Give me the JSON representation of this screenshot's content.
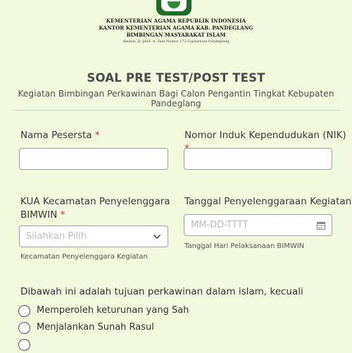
{
  "header": {
    "line1": "KEMENTERIAN AGAMA REPUBLIK INDONESIA",
    "line2": "KANTOR KEMENTERIAN AGAMA KAB. PANDEGLANG",
    "line3": "BIMBINGAN MASYARAKAT ISLAM",
    "address": "Alamat: Jl. Jend. A. Yani Nomor 172 Cigeureum Pandeglang"
  },
  "form": {
    "title": "SOAL PRE TEST/POST TEST",
    "subtitle": "Kegiatan Bimbingan Perkawinan Bagi Calon Pengantin Tingkat Kebupaten Pandeglang",
    "required_mark": "*",
    "fields": {
      "name": {
        "label": "Nama Pesersta",
        "value": ""
      },
      "nik": {
        "label": "Nomor Induk Kependudukan (NIK)",
        "value": ""
      },
      "kua": {
        "label_line1": "KUA Kecamatan Penyelenggara",
        "label_line2": "BIMWIN",
        "placeholder": "Silahkan Pilih",
        "help": "Kecamatan Penyelenggara Kegiatan"
      },
      "date": {
        "label": "Tanggal Penyelenggaraan Kegiatan",
        "placeholder": "MM-DD-TTTT",
        "help": "Tanggal Hari Pelaksanaan BIMWIN"
      }
    },
    "question": {
      "text": "Dibawah ini adalah tujuan perkawinan dalam islam, kecuali",
      "options": [
        "Memperoleh keturunan yang Sah",
        "Menjalankan Sunah Rasul"
      ]
    }
  },
  "colors": {
    "background": "#f0f9de",
    "required": "#d32f2f",
    "logo": "#1f6b2a"
  },
  "icons": {
    "select": "chevron-down-icon",
    "date": "calendar-icon"
  }
}
